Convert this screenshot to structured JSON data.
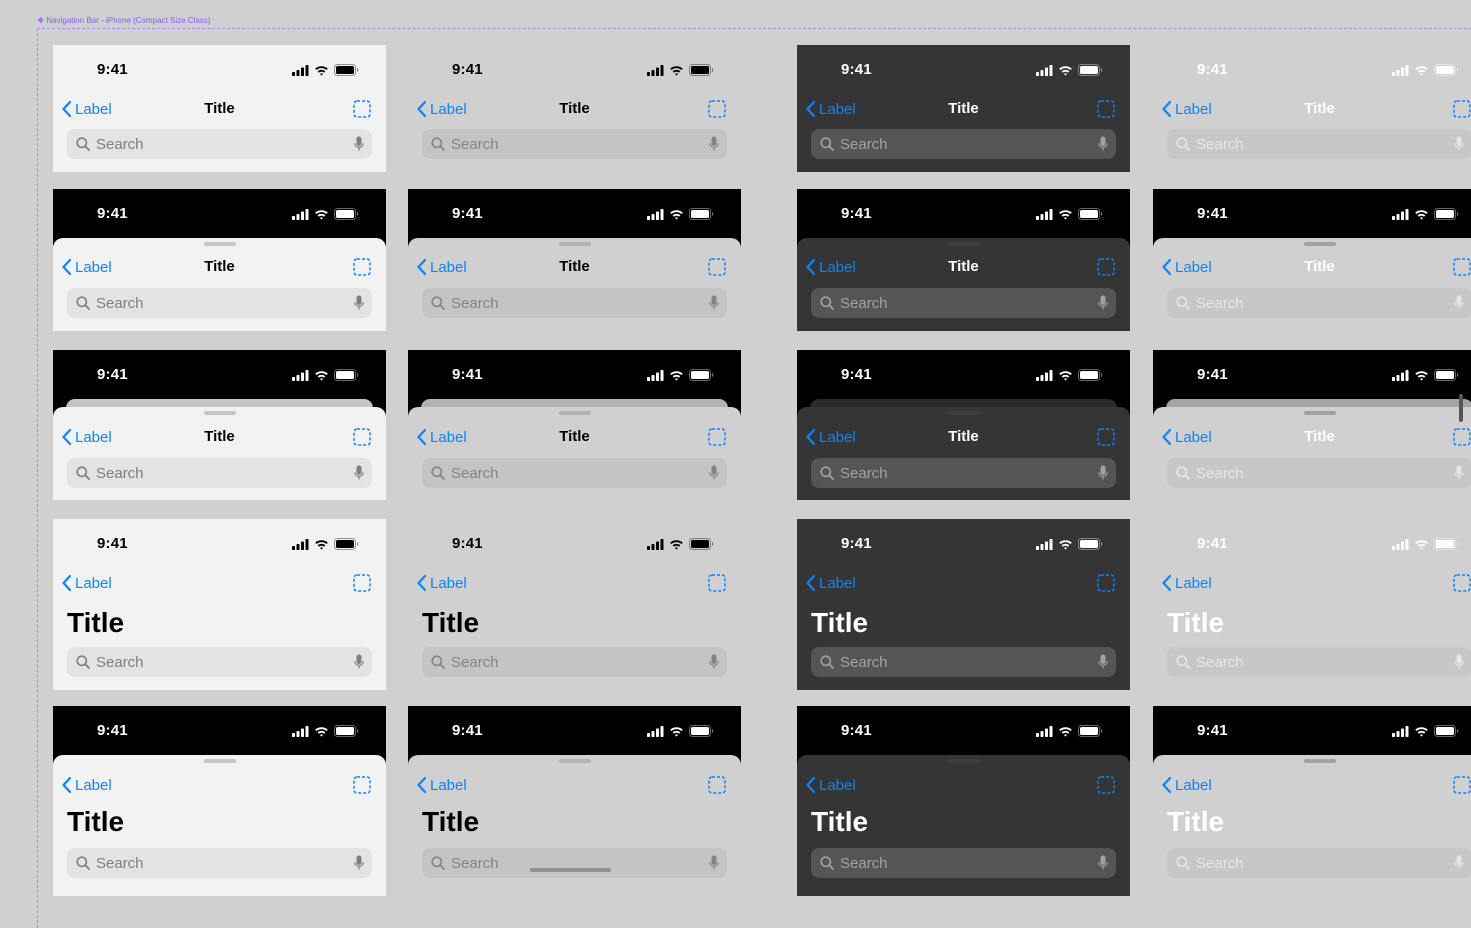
{
  "canvas": {
    "frame_label": "❖ Navigation Bar - iPhone (Compact Size Class)"
  },
  "status_bar": {
    "time": "9:41"
  },
  "nav": {
    "back_label": "Label",
    "title": "Title",
    "search_placeholder": "Search"
  },
  "themes": [
    {
      "name": "light",
      "card_background": "#f2f2f2",
      "text_color": "#000000",
      "status_icon_color": "#000000",
      "search_field_color": "#e3e3e5",
      "search_text_color": "#7e7e83",
      "grabber_color": "#c6c6c8",
      "sheet_behind_color": "#c4c4c4"
    },
    {
      "name": "light-transparent",
      "card_background": "#d0d0d0",
      "text_color": "#000000",
      "status_icon_color": "#000000",
      "search_field_color": "#c4c4c5",
      "search_text_color": "#83838a",
      "grabber_color": "#b3b3b6",
      "sheet_behind_color": "#b2b2b2"
    },
    {
      "name": "dark",
      "card_background": "#353535",
      "text_color": "#ffffff",
      "status_icon_color": "#ffffff",
      "search_field_color": "#555558",
      "search_text_color": "#a2a2a6",
      "grabber_color": "#3d3d3d",
      "sheet_behind_color": "#2a2a2a"
    },
    {
      "name": "dark-transparent",
      "card_background": "#d0d0d0",
      "text_color": "#ffffff",
      "status_icon_color": "#ffffff",
      "search_field_color": "#c7c7c9",
      "search_text_color": "#e6e6e6",
      "grabber_color": "#a2a2a2",
      "sheet_behind_color": "#a4a4a4"
    }
  ],
  "variants": [
    {
      "style": "standard",
      "presentation": "full-screen",
      "status_bar_background": "theme"
    },
    {
      "style": "standard",
      "presentation": "sheet",
      "status_bar_background": "#000000"
    },
    {
      "style": "standard",
      "presentation": "stacked-sheet",
      "status_bar_background": "#000000"
    },
    {
      "style": "large-title",
      "presentation": "full-screen",
      "status_bar_background": "theme"
    },
    {
      "style": "large-title",
      "presentation": "sheet",
      "status_bar_background": "#000000"
    }
  ],
  "accent_color": "#0a84ff"
}
